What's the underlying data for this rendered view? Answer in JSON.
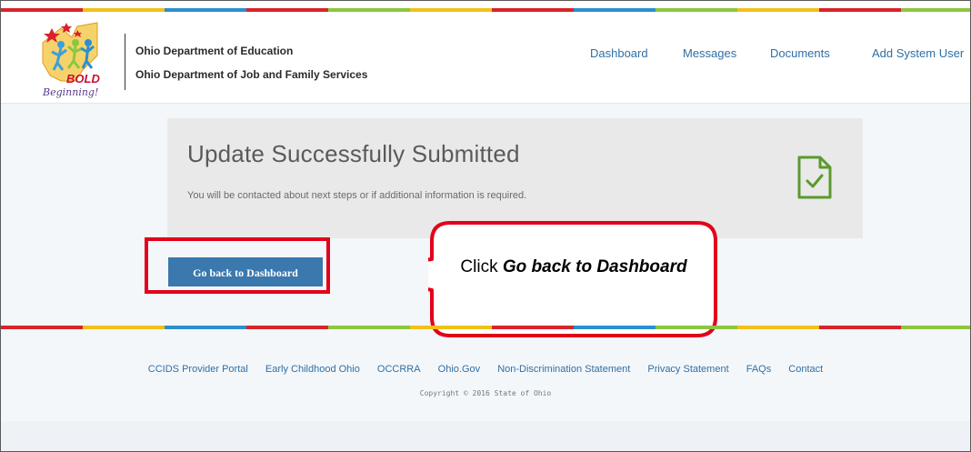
{
  "header": {
    "logo_text_bold": "BOLD",
    "logo_text_script": "Beginning!",
    "org_line1": "Ohio Department of Education",
    "org_line2": "Ohio Department of Job and Family Services",
    "nav": [
      {
        "label": "Dashboard"
      },
      {
        "label": "Messages"
      },
      {
        "label": "Documents"
      },
      {
        "label": "Add System User"
      }
    ]
  },
  "panel": {
    "title": "Update Successfully Submitted",
    "message": "You will be contacted about next steps or if additional information is required.",
    "icon": "document-check-icon"
  },
  "actions": {
    "back_label": "Go back to Dashboard"
  },
  "callout": {
    "prefix": "Click ",
    "emphasis": "Go back to Dashboard"
  },
  "footer": {
    "links": [
      {
        "label": "CCIDS Provider Portal"
      },
      {
        "label": "Early Childhood Ohio"
      },
      {
        "label": "OCCRRA"
      },
      {
        "label": "Ohio.Gov"
      },
      {
        "label": "Non-Discrimination Statement"
      },
      {
        "label": "Privacy Statement"
      },
      {
        "label": "FAQs"
      },
      {
        "label": "Contact"
      }
    ],
    "copyright": "Copyright © 2016 State of Ohio"
  },
  "colors": {
    "accent_blue": "#3a78ae",
    "link_blue": "#2f6fa5",
    "highlight_red": "#e3001b",
    "success_green": "#5a9a2e"
  }
}
